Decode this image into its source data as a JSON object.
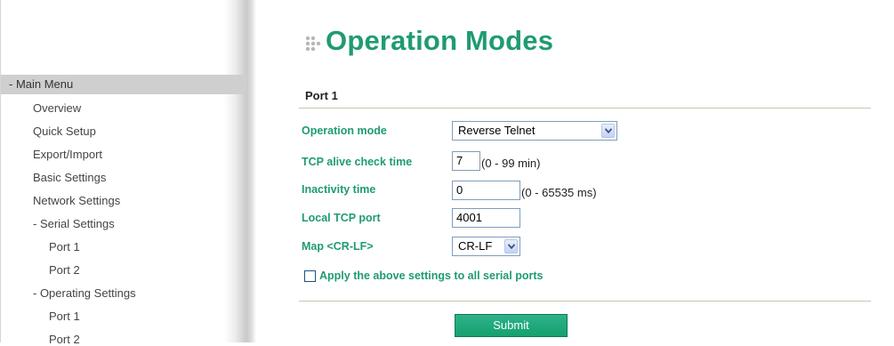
{
  "sidebar": {
    "header": "- Main Menu",
    "items": [
      "Overview",
      "Quick Setup",
      "Export/Import",
      "Basic Settings",
      "Network Settings",
      "- Serial Settings",
      "Port 1",
      "Port 2",
      "- Operating Settings",
      "Port 1",
      "Port 2"
    ]
  },
  "page": {
    "title": "Operation Modes",
    "section": "Port 1"
  },
  "form": {
    "operation_mode": {
      "label": "Operation mode",
      "value": "Reverse Telnet"
    },
    "tcp_alive": {
      "label": "TCP alive check time",
      "value": "7",
      "hint": "(0 - 99 min)"
    },
    "inactivity": {
      "label": "Inactivity time",
      "value": "0",
      "hint": "(0 - 65535 ms)"
    },
    "local_tcp_port": {
      "label": "Local TCP port",
      "value": "4001"
    },
    "map_crlf": {
      "label": "Map <CR-LF>",
      "value": "CR-LF"
    },
    "apply_all": {
      "label": "Apply the above settings to all serial ports",
      "checked": false
    },
    "submit_label": "Submit"
  },
  "colors": {
    "accent": "#1f9b73",
    "submit": "#14a070",
    "menu_header_bg": "#cfcfcf"
  }
}
